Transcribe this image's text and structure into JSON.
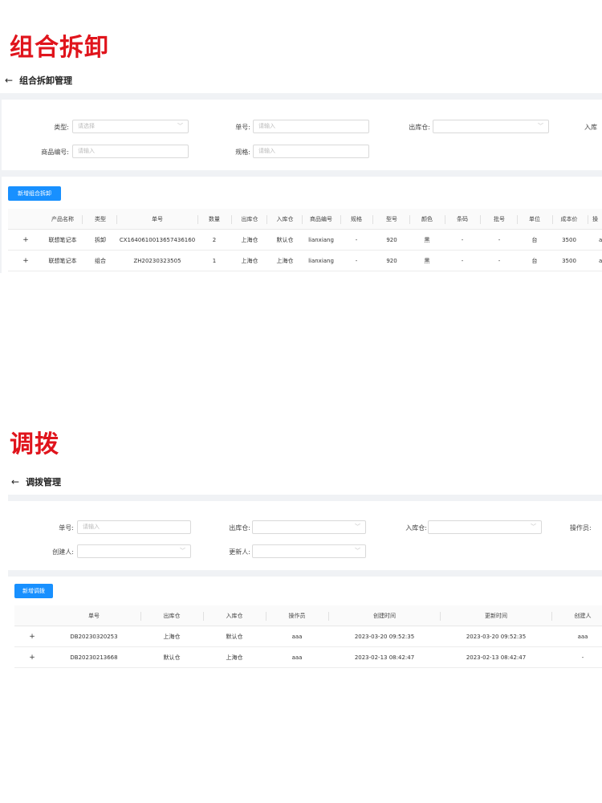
{
  "section1": {
    "title": "组合拆卸",
    "header": "组合拆卸管理",
    "filters": {
      "type_label": "类型:",
      "type_placeholder": "请选择",
      "order_label": "单号:",
      "order_placeholder": "请输入",
      "out_wh_label": "出库仓:",
      "in_wh_label": "入库",
      "product_code_label": "商品编号:",
      "product_code_placeholder": "请输入",
      "spec_label": "规格:",
      "spec_placeholder": "请输入"
    },
    "add_button": "新增组合拆卸",
    "columns": [
      "产品名称",
      "类型",
      "单号",
      "数量",
      "出库仓",
      "入库仓",
      "商品编号",
      "规格",
      "型号",
      "颜色",
      "条码",
      "批号",
      "单位",
      "成本价",
      "操"
    ],
    "rows": [
      [
        "联想笔记本",
        "拆卸",
        "CX1640610013657436160",
        "2",
        "上海仓",
        "默认仓",
        "lianxiang",
        "-",
        "920",
        "黑",
        "-",
        "-",
        "台",
        "3500",
        "a"
      ],
      [
        "联想笔记本",
        "组合",
        "ZH20230323505",
        "1",
        "上海仓",
        "上海仓",
        "lianxiang",
        "-",
        "920",
        "黑",
        "-",
        "-",
        "台",
        "3500",
        "a"
      ]
    ]
  },
  "section2": {
    "title": "调拨",
    "header": "调拨管理",
    "filters": {
      "order_label": "单号:",
      "order_placeholder": "请输入",
      "out_wh_label": "出库仓:",
      "in_wh_label": "入库仓:",
      "operator_label": "操作员:",
      "creator_label": "创建人:",
      "updater_label": "更新人:"
    },
    "add_button": "新增调拨",
    "columns": [
      "单号",
      "出库仓",
      "入库仓",
      "操作员",
      "创建时间",
      "更新时间",
      "创建人"
    ],
    "rows": [
      [
        "DB20230320253",
        "上海仓",
        "默认仓",
        "aaa",
        "2023-03-20 09:52:35",
        "2023-03-20 09:52:35",
        "aaa"
      ],
      [
        "DB20230213668",
        "默认仓",
        "上海仓",
        "aaa",
        "2023-02-13 08:42:47",
        "2023-02-13 08:42:47",
        "-"
      ]
    ]
  },
  "icons": {
    "back": "arrow-left-icon",
    "expand": "plus-icon",
    "dropdown": "chevron-down-icon"
  },
  "colors": {
    "title_red": "#e0141c",
    "primary_blue": "#1890ff",
    "band_gray": "#f0f2f5"
  }
}
